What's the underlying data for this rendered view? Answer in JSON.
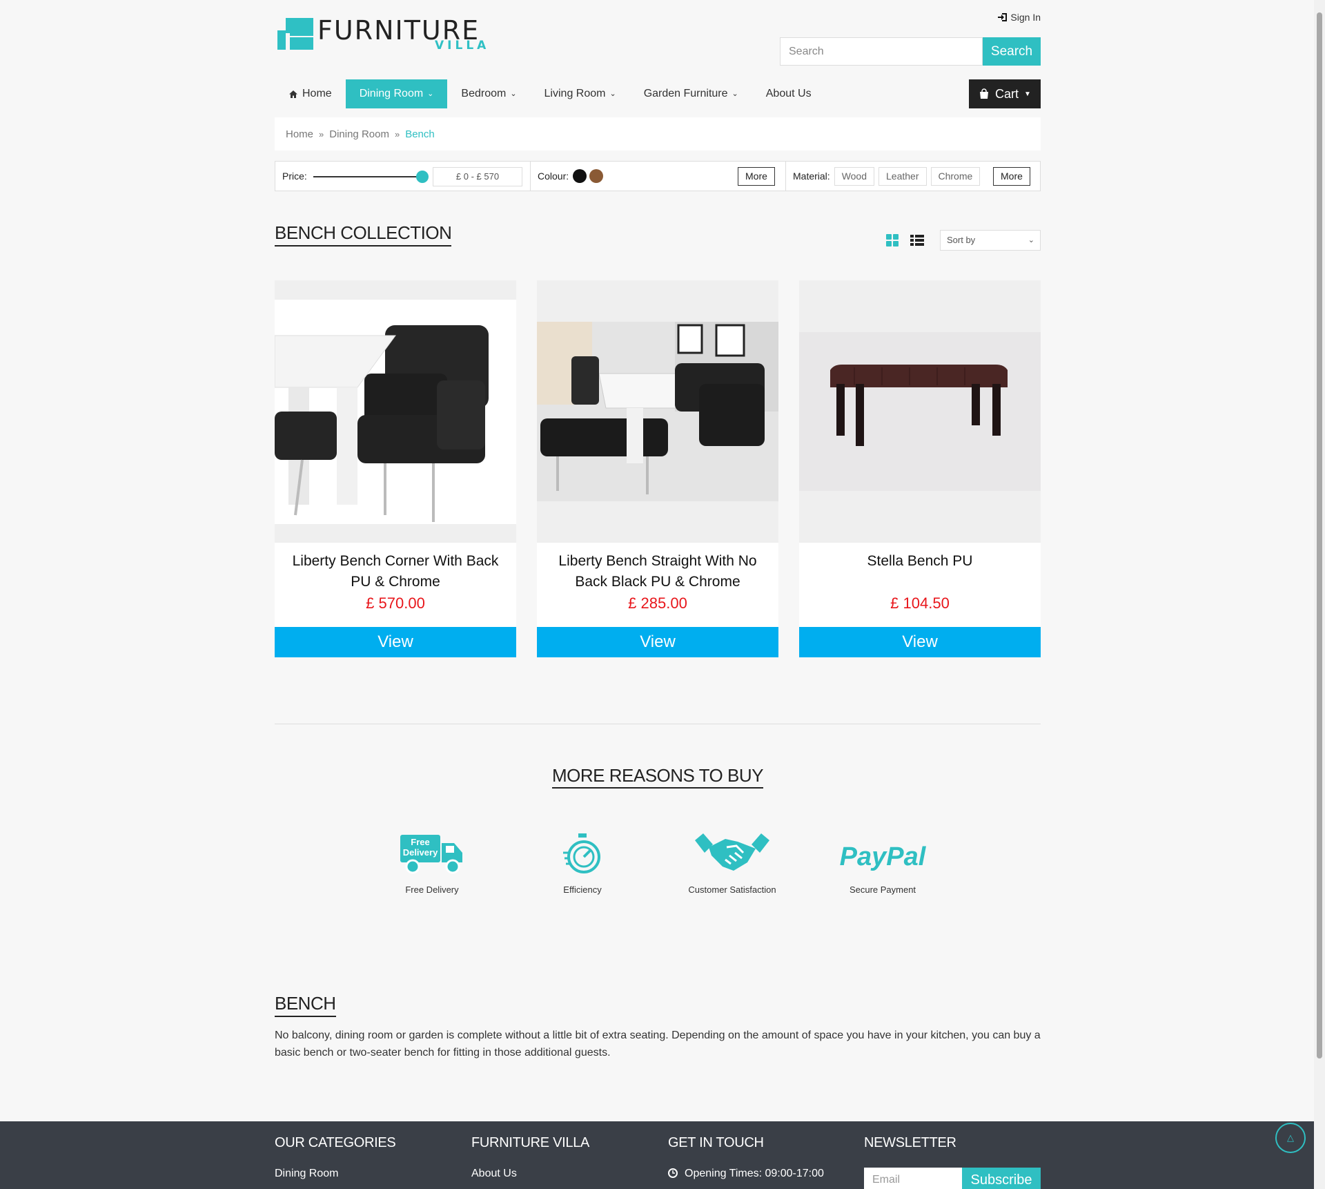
{
  "brand": {
    "name": "FURNITURE",
    "sub": "VILLA"
  },
  "header": {
    "sign_in": "Sign In",
    "search_placeholder": "Search",
    "search_button": "Search"
  },
  "nav": {
    "home": "Home",
    "dining_room": "Dining Room",
    "bedroom": "Bedroom",
    "living_room": "Living Room",
    "garden_furniture": "Garden Furniture",
    "about_us": "About Us",
    "cart": "Cart"
  },
  "breadcrumb": [
    "Home",
    "Dining Room",
    "Bench"
  ],
  "filters": {
    "price_label": "Price:",
    "price_range": "£ 0 - £ 570",
    "price_slider_fraction": 1.0,
    "colour_label": "Colour:",
    "colours": [
      "#111111",
      "#8a5a35"
    ],
    "more": "More",
    "material_label": "Material:",
    "materials": [
      "Wood",
      "Leather",
      "Chrome"
    ]
  },
  "collection": {
    "title": "BENCH COLLECTION",
    "sort_label": "Sort by"
  },
  "products": [
    {
      "name": "Liberty Bench Corner With Back PU & Chrome",
      "price": "£ 570.00",
      "action": "View"
    },
    {
      "name": "Liberty Bench Straight With No Back Black PU & Chrome",
      "price": "£ 285.00",
      "action": "View"
    },
    {
      "name": "Stella Bench PU",
      "price": "£ 104.50",
      "action": "View"
    }
  ],
  "reasons": {
    "title": "MORE REASONS TO BUY",
    "items": [
      {
        "label": "Free Delivery",
        "icon": "delivery-truck-icon",
        "icon_text": [
          "Free",
          "Delivery"
        ]
      },
      {
        "label": "Efficiency",
        "icon": "stopwatch-icon"
      },
      {
        "label": "Customer Satisfaction",
        "icon": "handshake-icon"
      },
      {
        "label": "Secure Payment",
        "icon": "paypal-logo",
        "icon_text": "PayPal"
      }
    ]
  },
  "description": {
    "title": "BENCH",
    "text": "No balcony, dining room or garden is complete without a little bit of extra seating. Depending on the amount of space you have in your kitchen, you can buy a basic bench or two-seater bench for fitting in those additional guests."
  },
  "footer": {
    "categories_title": "OUR CATEGORIES",
    "categories_first": "Dining Room",
    "villa_title": "FURNITURE VILLA",
    "villa_first": "About Us",
    "contact_title": "GET IN TOUCH",
    "contact_first": "Opening Times: 09:00-17:00",
    "newsletter_title": "NEWSLETTER",
    "email_placeholder": "Email",
    "subscribe": "Subscribe"
  },
  "colors": {
    "accent": "#2fbfc2",
    "view_button": "#00aeef",
    "price": "#e8161b",
    "footer": "#3a3f47"
  }
}
